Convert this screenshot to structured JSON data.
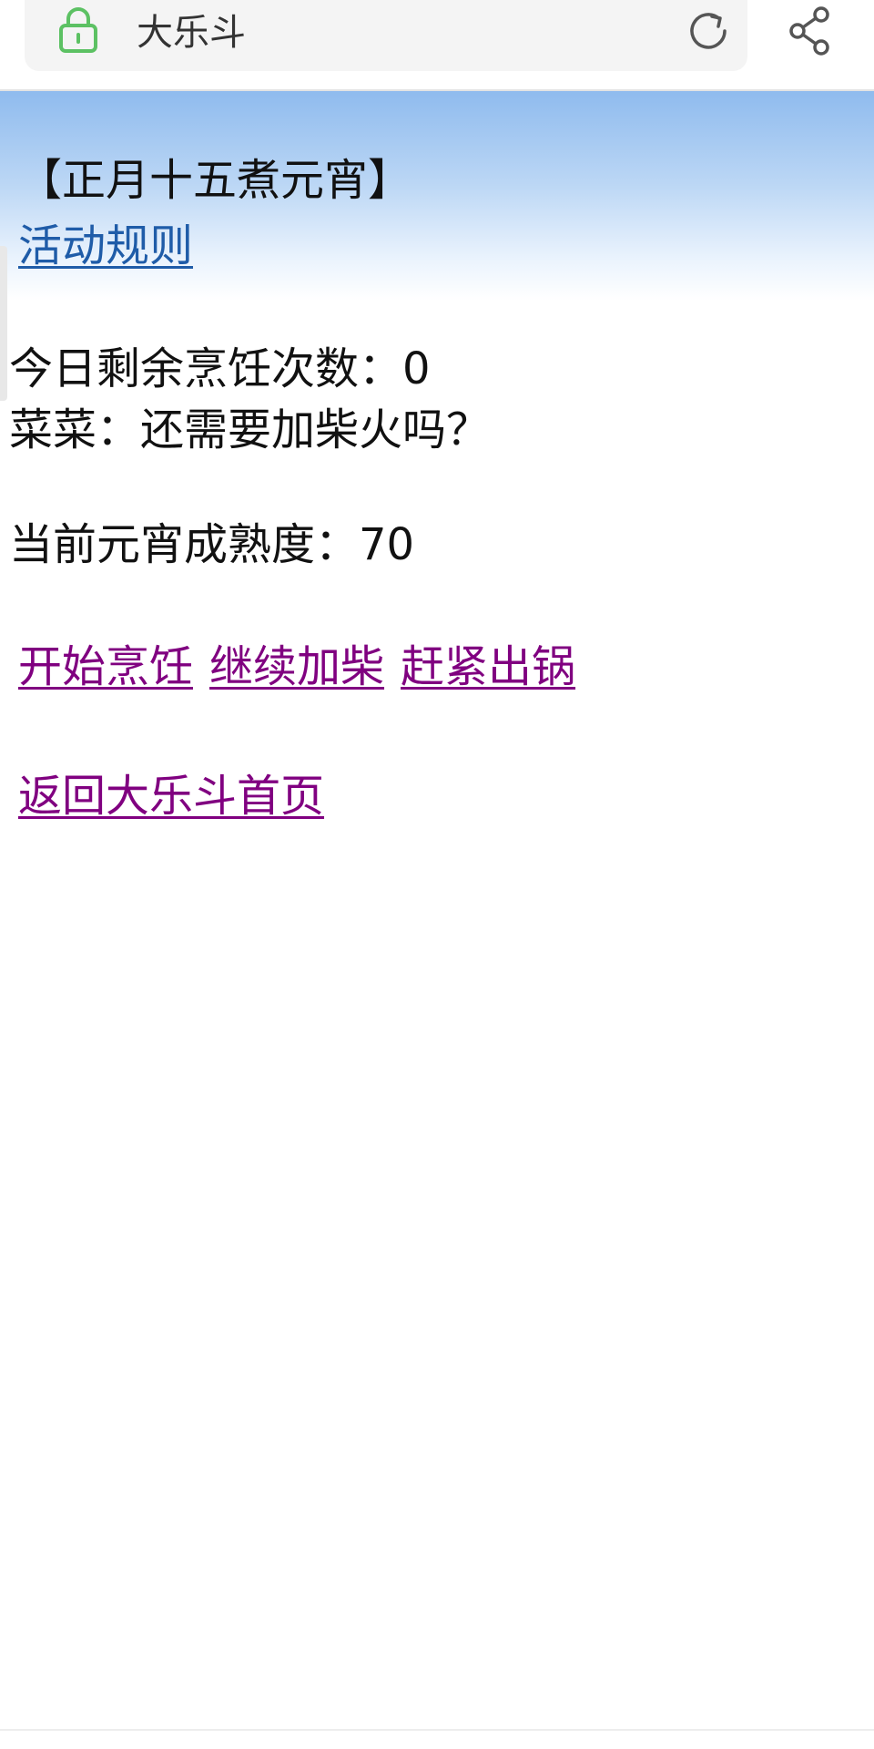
{
  "browser": {
    "site_title": "大乐斗",
    "icons": {
      "lock": "lock-icon",
      "reload": "reload-icon",
      "share": "share-icon"
    },
    "colors": {
      "lock_green": "#5cc163",
      "icon_gray": "#555555"
    }
  },
  "page": {
    "event_title": "【正月十五煮元宵】",
    "rules_link": "活动规则",
    "remaining_label": "今日剩余烹饪次数：0",
    "caicai_prompt": "菜菜：还需要加柴火吗？",
    "doneness_label": "当前元宵成熟度：70",
    "actions": [
      {
        "label": "开始烹饪"
      },
      {
        "label": "继续加柴"
      },
      {
        "label": "赶紧出锅"
      }
    ],
    "home_link": "返回大乐斗首页",
    "colors": {
      "link_blue": "#1f5ca8",
      "link_visited": "#800080",
      "header_gradient_top": "#8fbbee"
    }
  }
}
